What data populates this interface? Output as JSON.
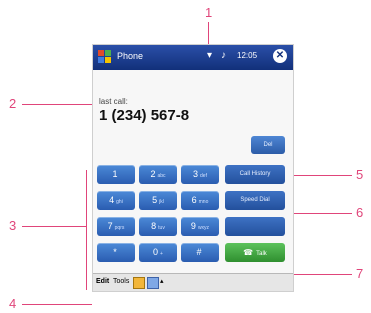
{
  "callouts": [
    "1",
    "2",
    "3",
    "4",
    "5",
    "6",
    "7"
  ],
  "titlebar": {
    "app_title": "Phone",
    "time": "12:05",
    "close_glyph": "✕"
  },
  "dialer": {
    "last_call_label": "last call:",
    "number": "1 (234) 567-8",
    "delete_label": "Del"
  },
  "keypad": [
    {
      "digit": "1",
      "sub": "",
      "name": "key-1"
    },
    {
      "digit": "2",
      "sub": "abc",
      "name": "key-2"
    },
    {
      "digit": "3",
      "sub": "def",
      "name": "key-3"
    },
    {
      "digit": "4",
      "sub": "ghi",
      "name": "key-4"
    },
    {
      "digit": "5",
      "sub": "jkl",
      "name": "key-5"
    },
    {
      "digit": "6",
      "sub": "mno",
      "name": "key-6"
    },
    {
      "digit": "7",
      "sub": "pqrs",
      "name": "key-7"
    },
    {
      "digit": "8",
      "sub": "tuv",
      "name": "key-8"
    },
    {
      "digit": "9",
      "sub": "wxyz",
      "name": "key-9"
    },
    {
      "digit": "*",
      "sub": "",
      "name": "key-star"
    },
    {
      "digit": "0",
      "sub": "+",
      "name": "key-0"
    },
    {
      "digit": "#",
      "sub": "",
      "name": "key-hash"
    }
  ],
  "side_buttons": {
    "call_history": "Call History",
    "speed_dial": "Speed Dial",
    "talk": "Talk"
  },
  "menubar": {
    "edit": "Edit",
    "tools": "Tools"
  },
  "colors": {
    "callout": "#e0457a",
    "title_bar": "#2b4fa8",
    "key_blue": "#2a5cb0",
    "talk_green": "#2f8f2f"
  }
}
